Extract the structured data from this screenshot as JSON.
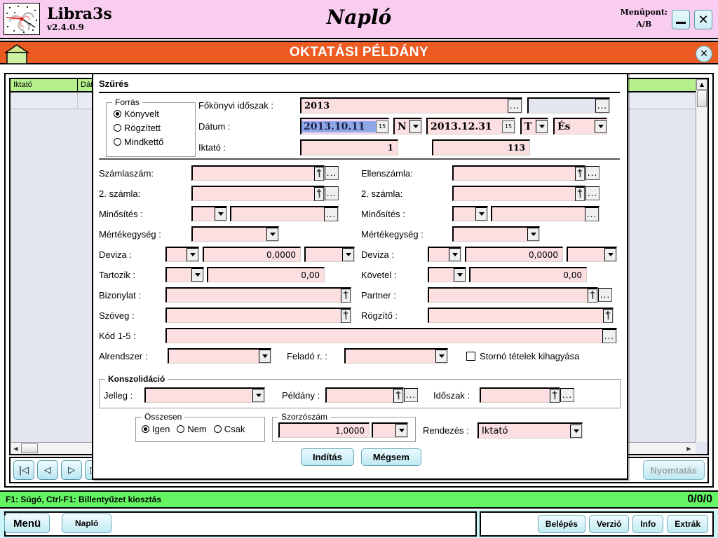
{
  "header": {
    "brand_name": "Libra3s",
    "version": "v2.4.0.9",
    "window_title": "Napló",
    "menupoint_label": "Menüpont:",
    "menupoint_value": "A/B",
    "minimize_label": "_",
    "close_label": "✕"
  },
  "banner": {
    "text": "OKTATÁSI PÉLDÁNY",
    "close_label": "✕"
  },
  "grid": {
    "columns": [
      "Iktató",
      "Dátum",
      ""
    ],
    "rows": [
      [
        "",
        "",
        ""
      ]
    ]
  },
  "nav": {
    "first": "|◁",
    "prev": "◁",
    "next": "▷",
    "last": "▷|",
    "print_label": "Nyomtatás"
  },
  "dialog": {
    "title": "Szűrés",
    "source_group": {
      "legend": "Forrás",
      "options": [
        "Könyvelt",
        "Rögzített",
        "Mindkettő"
      ],
      "selected": "Könyvelt"
    },
    "period": {
      "label": "Főkönyvi időszak :",
      "value": "2013",
      "browse": "...",
      "extra_value": "",
      "extra_browse": "..."
    },
    "date": {
      "label": "Dátum :",
      "from": "2013.10.11",
      "to": "2013.12.31",
      "op1": "N",
      "op2": "T",
      "join": "És",
      "calendar_icon": "15"
    },
    "iktato": {
      "label": "Iktató :",
      "from": "1",
      "to": "113"
    },
    "left_fields": {
      "szamlaszam_label": "Számlaszám:",
      "szamlaszam_value": "",
      "szamla2_label": "2. számla:",
      "szamla2_value": "",
      "minosites_label": "Minősítés :",
      "minosites_code": "",
      "minosites_value": "",
      "mertekegyseg_label": "Mértékegység :",
      "mertekegyseg_value": "",
      "deviza_label": "Deviza :",
      "deviza_code": "",
      "deviza_value": "0,0000",
      "deviza_unit": "",
      "tartozik_label": "Tartozik :",
      "tartozik_op": "",
      "tartozik_value": "0,00",
      "bizonylat_label": "Bizonylat :",
      "bizonylat_value": "",
      "szoveg_label": "Szöveg :",
      "szoveg_value": "",
      "kod_label": "Kód 1-5 :",
      "kod_value": "",
      "alrendszer_label": "Alrendszer :",
      "alrendszer_value": "",
      "felado_label": "Feladó r. :",
      "felado_value": ""
    },
    "right_fields": {
      "ellenszamla_label": "Ellenszámla:",
      "ellenszamla_value": "",
      "szamla2_label": "2. számla:",
      "szamla2_value": "",
      "minosites_label": "Minősítés :",
      "minosites_code": "",
      "minosites_value": "",
      "mertekegyseg_label": "Mértékegység :",
      "mertekegyseg_value": "",
      "deviza_label": "Deviza :",
      "deviza_code": "",
      "deviza_value": "0,0000",
      "deviza_unit": "",
      "kovetel_label": "Követel :",
      "kovetel_op": "",
      "kovetel_value": "0,00",
      "partner_label": "Partner :",
      "partner_value": "",
      "rogzito_label": "Rögzítő :",
      "rogzito_value": "",
      "storno_label": "Stornó tételek kihagyása",
      "storno_checked": false
    },
    "konszolidacio": {
      "legend": "Konszolidáció",
      "jelleg_label": "Jelleg :",
      "jelleg_value": "",
      "peldany_label": "Példány :",
      "peldany_value": "",
      "idoszak_label": "Időszak :",
      "idoszak_value": ""
    },
    "osszesen": {
      "legend": "Összesen",
      "options": [
        "Igen",
        "Nem",
        "Csak"
      ],
      "selected": "Igen"
    },
    "szorzoszam": {
      "legend": "Szorzószám",
      "value": "1,0000",
      "unit": ""
    },
    "rendezes": {
      "label": "Rendezés :",
      "value": "Iktató"
    },
    "buttons": {
      "start": "Indítás",
      "cancel": "Mégsem"
    },
    "round_marker": "I"
  },
  "statusbar": {
    "hint": "F1: Súgó, Ctrl-F1: Billentyűzet kiosztás",
    "counter": "0/0/0"
  },
  "bottombar": {
    "menu": "Menü",
    "naplo": "Napló",
    "right_buttons": [
      "Belépés",
      "Verzió",
      "Info",
      "Extrák"
    ]
  }
}
